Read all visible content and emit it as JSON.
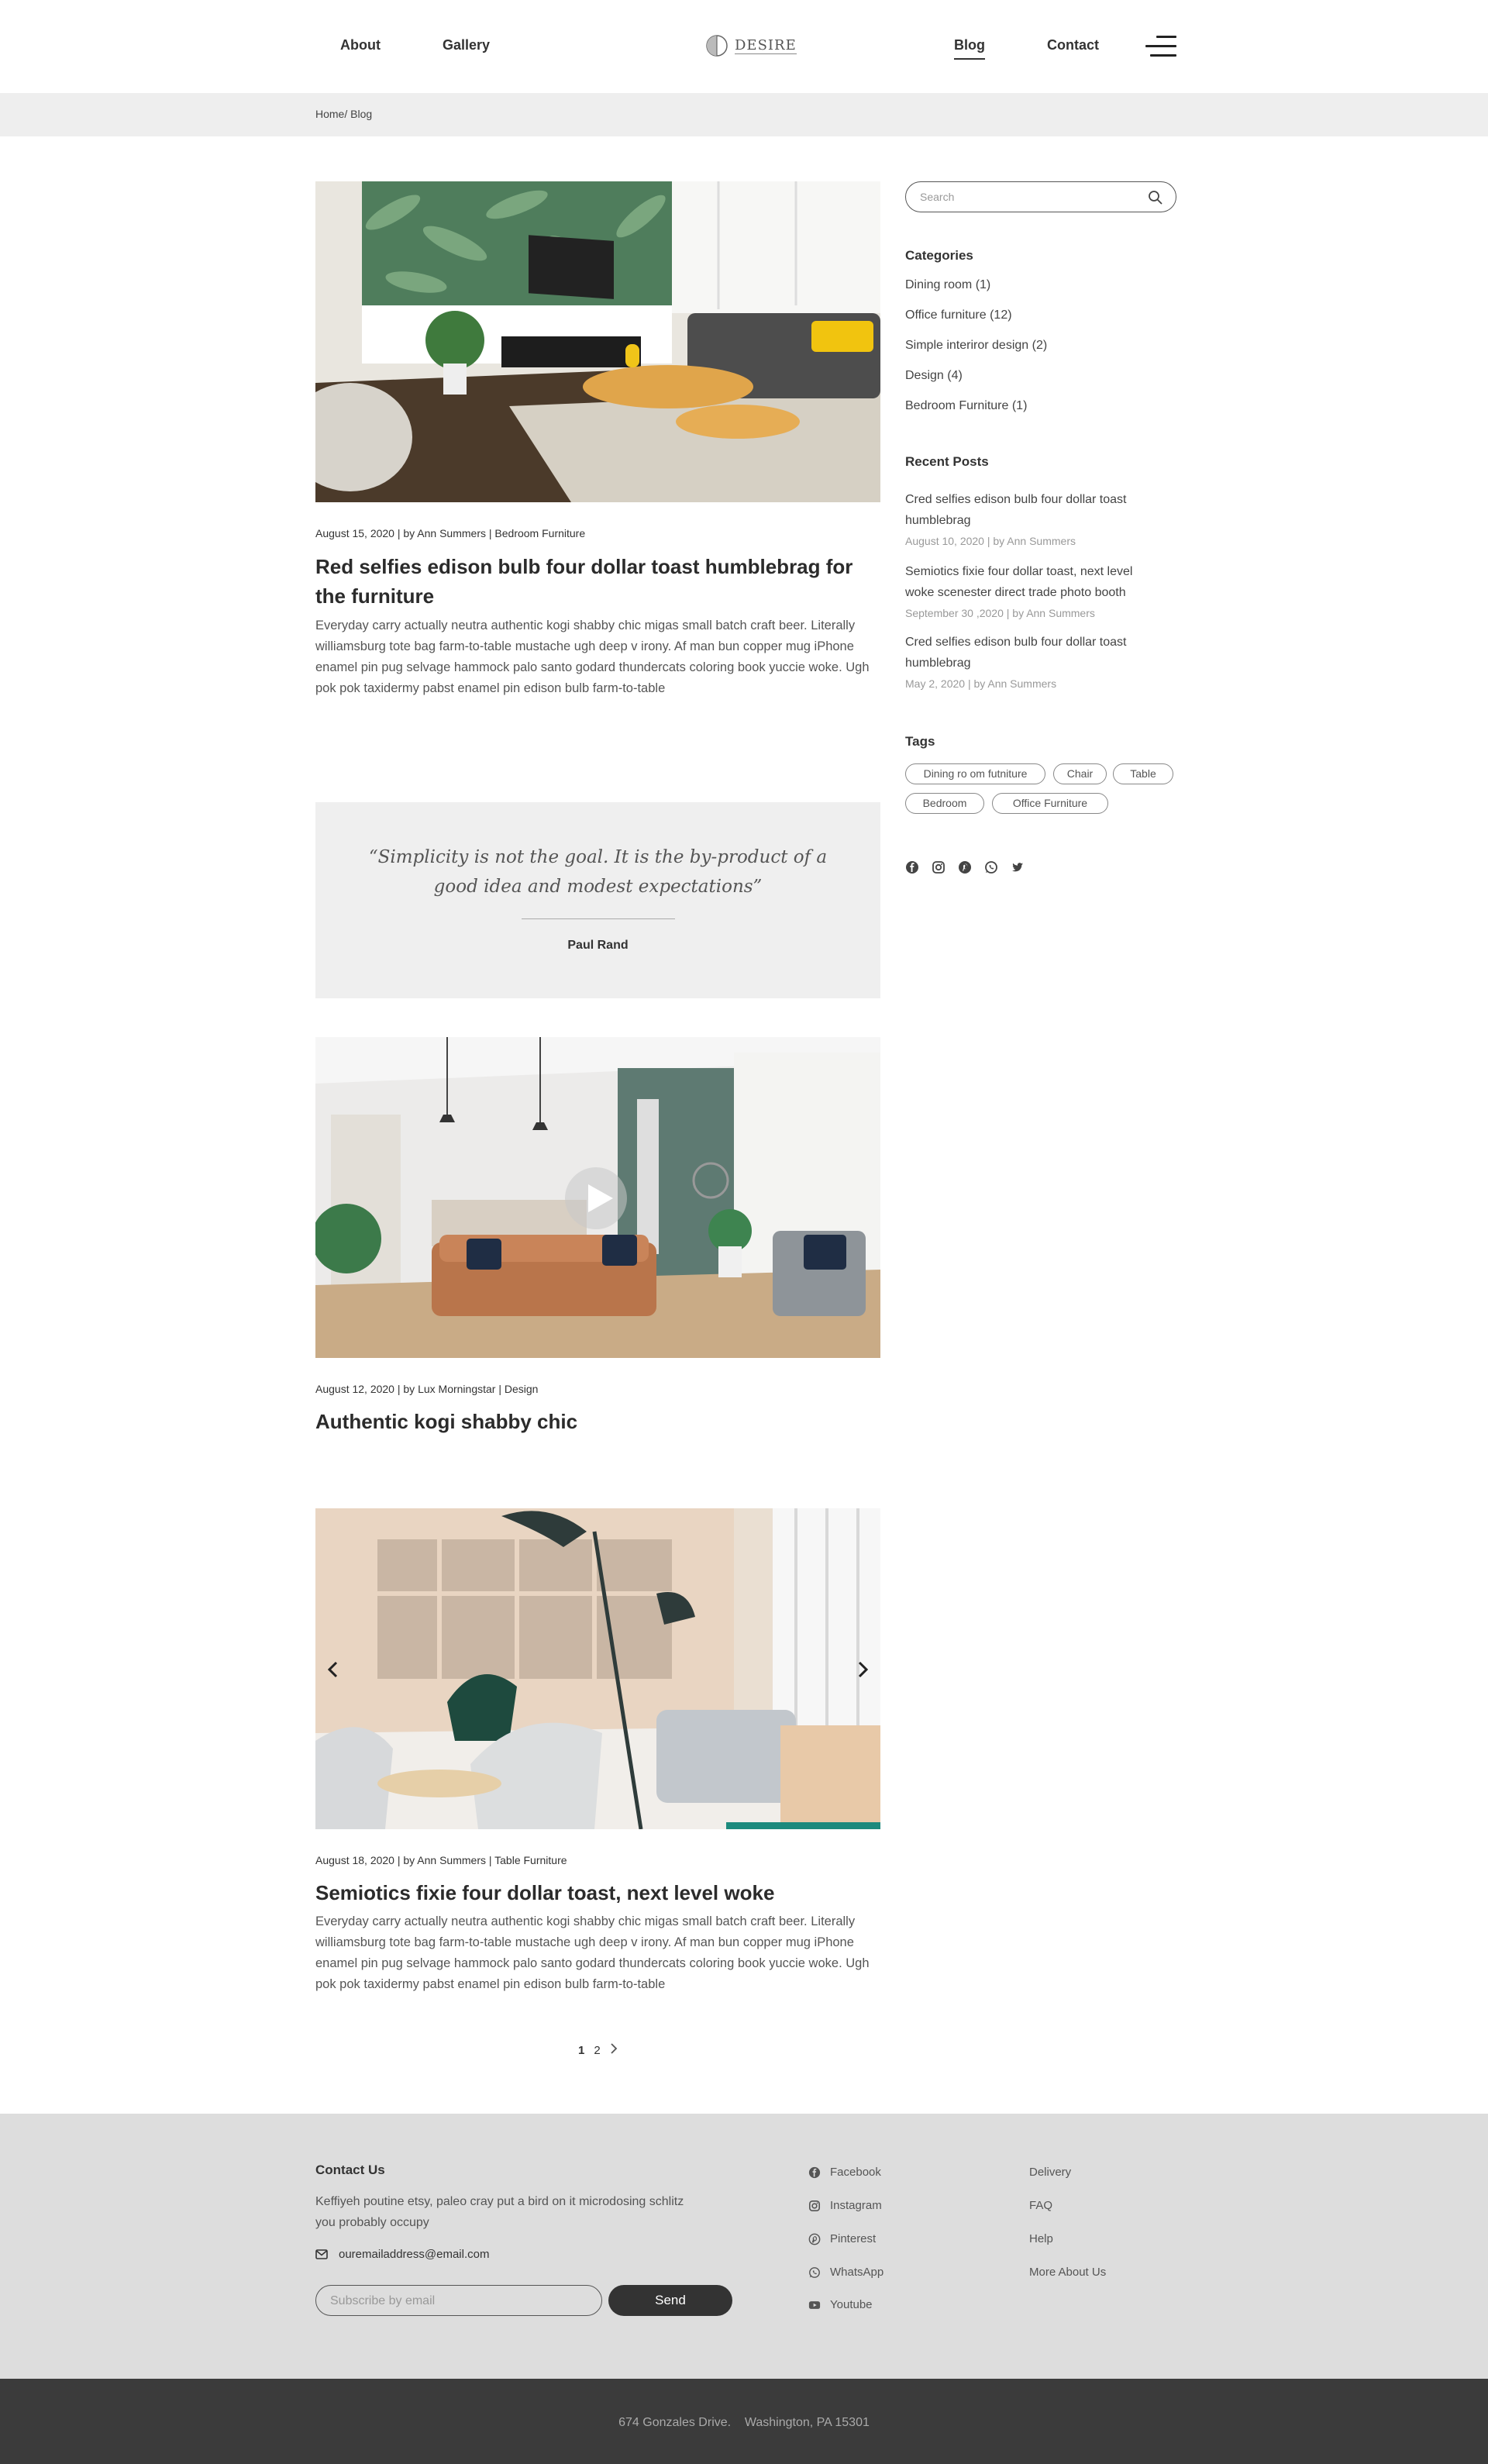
{
  "header": {
    "nav": {
      "about": "About",
      "gallery": "Gallery",
      "blog": "Blog",
      "contact": "Contact"
    },
    "logo_text": "DESIRE"
  },
  "breadcrumb": "Home/ Blog",
  "posts": [
    {
      "meta": "August 15, 2020 | by Ann Summers | Bedroom Furniture",
      "title": "Red selfies edison bulb four dollar toast humblebrag for the furniture",
      "excerpt": "Everyday carry actually neutra authentic kogi shabby chic migas small batch craft beer. Literally williamsburg tote bag farm-to-table mustache ugh deep v irony. Af man bun copper mug iPhone enamel pin pug selvage hammock palo santo godard thundercats coloring book yuccie woke. Ugh pok pok taxidermy pabst enamel pin edison bulb farm-to-table"
    },
    {
      "meta": "August 12, 2020 | by Lux Morningstar | Design",
      "title": "Authentic kogi shabby chic"
    },
    {
      "meta": "August 18, 2020 | by Ann Summers | Table Furniture",
      "title": "Semiotics fixie four dollar toast, next level woke",
      "excerpt": "Everyday carry actually neutra authentic kogi shabby chic migas small batch craft beer. Literally williamsburg tote bag farm-to-table mustache ugh deep v irony. Af man bun copper mug iPhone enamel pin pug selvage hammock palo santo godard thundercats coloring book yuccie woke. Ugh pok pok taxidermy pabst enamel pin edison bulb farm-to-table"
    }
  ],
  "quote": {
    "text": "“Simplicity is not the goal. It is the by-product of a good idea and modest expectations”",
    "author": "Paul Rand"
  },
  "pagination": {
    "pages": [
      "1",
      "2"
    ],
    "current": "1",
    "next_icon": "chevron-right-icon"
  },
  "sidebar": {
    "search_placeholder": "Search",
    "categories_heading": "Categories",
    "categories": [
      "Dining room (1)",
      "Office furniture (12)",
      "Simple interiror design (2)",
      "Design (4)",
      "Bedroom Furniture (1)"
    ],
    "recent_heading": "Recent Posts",
    "recent": [
      {
        "title": "Cred selfies edison bulb four dollar toast humblebrag",
        "meta": "August 10, 2020 | by Ann Summers"
      },
      {
        "title": "Semiotics fixie four dollar toast, next level woke scenester direct trade photo booth",
        "meta": "September 30 ,2020 | by Ann Summers"
      },
      {
        "title": "Cred selfies edison bulb four dollar toast humblebrag",
        "meta": "May 2, 2020 | by Ann Summers"
      }
    ],
    "tags_heading": "Tags",
    "tags": [
      "Dining ro om futniture",
      "Chair",
      "Table",
      "Bedroom",
      "Office Furniture"
    ],
    "social_icons": [
      "facebook-icon",
      "instagram-icon",
      "pinterest-icon",
      "whatsapp-icon",
      "twitter-icon"
    ]
  },
  "footer": {
    "contact_heading": "Contact Us",
    "contact_text": "Keffiyeh poutine etsy, paleo cray put a bird on it microdosing schlitz you probably occupy",
    "email": "ouremailaddress@email.com",
    "subscribe_placeholder": "Subscribe by email",
    "send_label": "Send",
    "social": [
      "Facebook",
      "Instagram",
      "Pinterest",
      "WhatsApp",
      "Youtube"
    ],
    "links": [
      "Delivery",
      "FAQ",
      "Help",
      "More About Us"
    ],
    "address": "674 Gonzales Drive.    Washington, PA 15301"
  },
  "colors": {
    "text_dark": "#2d2d2d",
    "light_gray_bg": "#eeeeee",
    "footer_bg": "#dddddd",
    "bottom_bar_bg": "#3b3b3b",
    "button_bg": "#333333"
  }
}
